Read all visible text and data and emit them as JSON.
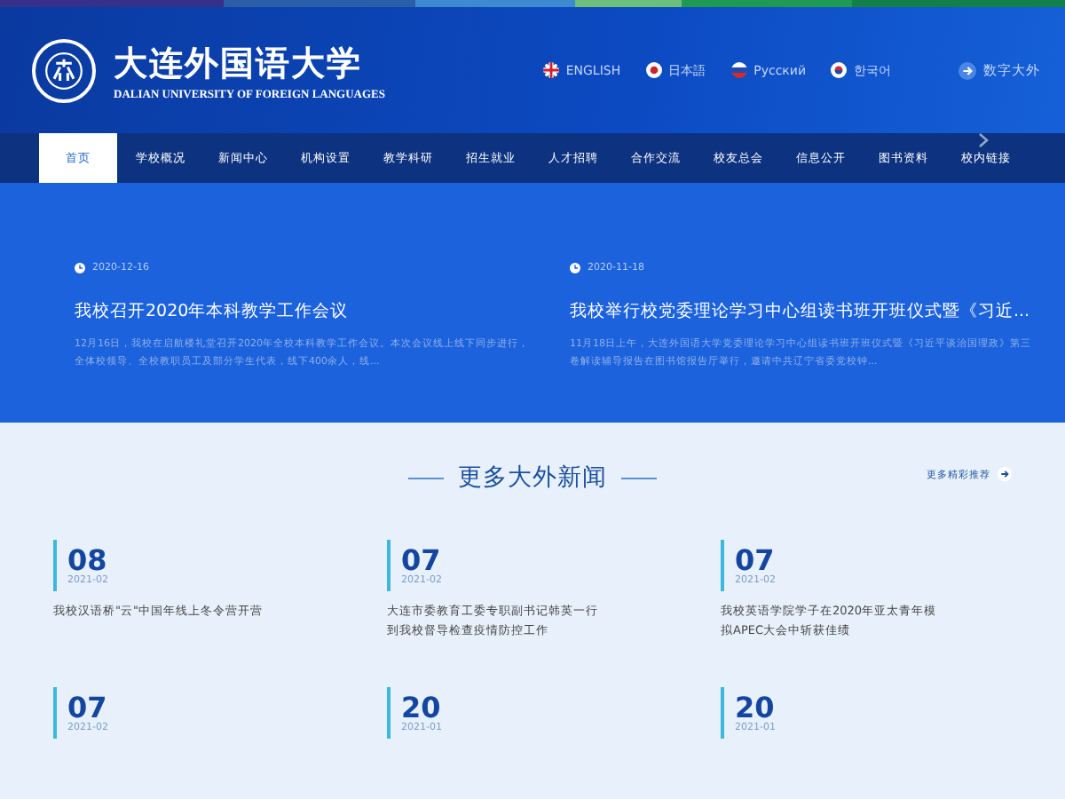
{
  "header": {
    "name_cn": "大连外国语大学",
    "name_en": "DALIAN UNIVERSITY OF FOREIGN LANGUAGES",
    "languages": [
      {
        "label": "ENGLISH",
        "kind": "uk"
      },
      {
        "label": "日本語",
        "kind": "jp"
      },
      {
        "label": "Русский",
        "kind": "ru"
      },
      {
        "label": "한국어",
        "kind": "kr"
      }
    ],
    "digital": "数字大外"
  },
  "nav": [
    {
      "label": "首页",
      "selected": true
    },
    {
      "label": "学校概况",
      "selected": false
    },
    {
      "label": "新闻中心",
      "selected": false
    },
    {
      "label": "机构设置",
      "selected": false
    },
    {
      "label": "教学科研",
      "selected": false
    },
    {
      "label": "招生就业",
      "selected": false
    },
    {
      "label": "人才招聘",
      "selected": false
    },
    {
      "label": "合作交流",
      "selected": false
    },
    {
      "label": "校友总会",
      "selected": false
    },
    {
      "label": "信息公开",
      "selected": false
    },
    {
      "label": "图书资料",
      "selected": false
    },
    {
      "label": "校内链接",
      "selected": false
    }
  ],
  "banner": [
    {
      "date": "2020-12-16",
      "title": "我校召开2020年本科教学工作会议",
      "summary": "12月16日，我校在启航楼礼堂召开2020年全校本科教学工作会议。本次会议线上线下同步进行，全体校领导、全校教职员工及部分学生代表，线下400余人，线..."
    },
    {
      "date": "2020-11-18",
      "title": "我校举行校党委理论学习中心组读书班开班仪式暨《习近...",
      "summary": "11月18日上午，大连外国语大学党委理论学习中心组读书班开班仪式暨《习近平谈治国理政》第三卷解读辅导报告在图书馆报告厅举行，邀请中共辽宁省委党校钟..."
    }
  ],
  "news_section": {
    "title": "更多大外新闻",
    "more": "更多精彩推荐",
    "items": [
      {
        "day": "08",
        "month": "2021-02",
        "title": "我校汉语桥\"云\"中国年线上冬令营开营"
      },
      {
        "day": "07",
        "month": "2021-02",
        "title": "大连市委教育工委专职副书记韩英一行到我校督导检查疫情防控工作"
      },
      {
        "day": "07",
        "month": "2021-02",
        "title": "我校英语学院学子在2020年亚太青年模拟APEC大会中斩获佳绩"
      },
      {
        "day": "07",
        "month": "2021-02"
      },
      {
        "day": "20",
        "month": "2021-01"
      },
      {
        "day": "20",
        "month": "2021-01"
      }
    ]
  }
}
